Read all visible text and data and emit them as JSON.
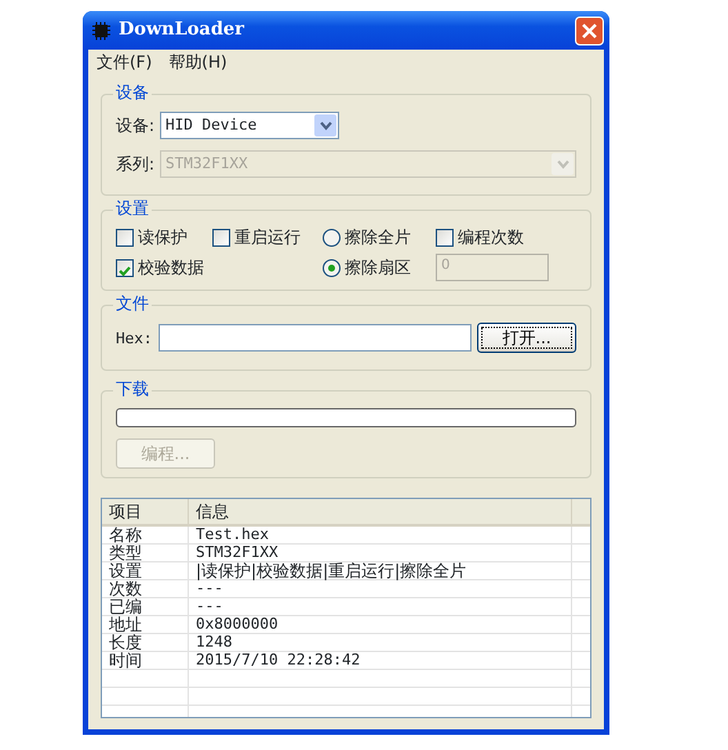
{
  "window": {
    "title": "DownLoader"
  },
  "menu": [
    {
      "label": "文件(F)"
    },
    {
      "label": "帮助(H)"
    }
  ],
  "device_group": {
    "title": "设备",
    "device": {
      "label": "设备:",
      "value": "HID Device",
      "disabled": false
    },
    "series": {
      "label": "系列:",
      "value": "STM32F1XX",
      "disabled": true
    }
  },
  "settings_group": {
    "title": "设置",
    "rows": [
      [
        {
          "kind": "checkbox",
          "label": "读保护",
          "checked": false
        },
        {
          "kind": "checkbox",
          "label": "重启运行",
          "checked": false
        },
        {
          "kind": "radio",
          "label": "擦除全片",
          "selected": false
        },
        {
          "kind": "checkbox",
          "label": "编程次数",
          "checked": false
        }
      ],
      [
        {
          "kind": "checkbox",
          "label": "校验数据",
          "checked": true
        },
        null,
        {
          "kind": "radio",
          "label": "擦除扇区",
          "selected": true
        },
        {
          "kind": "field",
          "value": "0",
          "disabled": true
        }
      ]
    ]
  },
  "file_group": {
    "title": "文件",
    "label": "Hex:",
    "button": {
      "label": "打开...",
      "focused": true
    }
  },
  "download_group": {
    "title": "下载",
    "progress": {
      "level": 0
    },
    "button": {
      "label": "编程...",
      "disabled": true
    }
  },
  "info_list": {
    "columns": [
      "项目",
      "信息"
    ],
    "rows": [
      {
        "item": "名称",
        "info": "Test.hex"
      },
      {
        "item": "类型",
        "info": "STM32F1XX"
      },
      {
        "item": "设置",
        "info": "|读保护|校验数据|重启运行|擦除全片"
      },
      {
        "item": "次数",
        "info": "---"
      },
      {
        "item": "已编",
        "info": "---"
      },
      {
        "item": "地址",
        "info": "0x8000000"
      },
      {
        "item": "长度",
        "info": "1248"
      },
      {
        "item": "时间",
        "info": "2015/7/10 22:28:42"
      }
    ]
  }
}
